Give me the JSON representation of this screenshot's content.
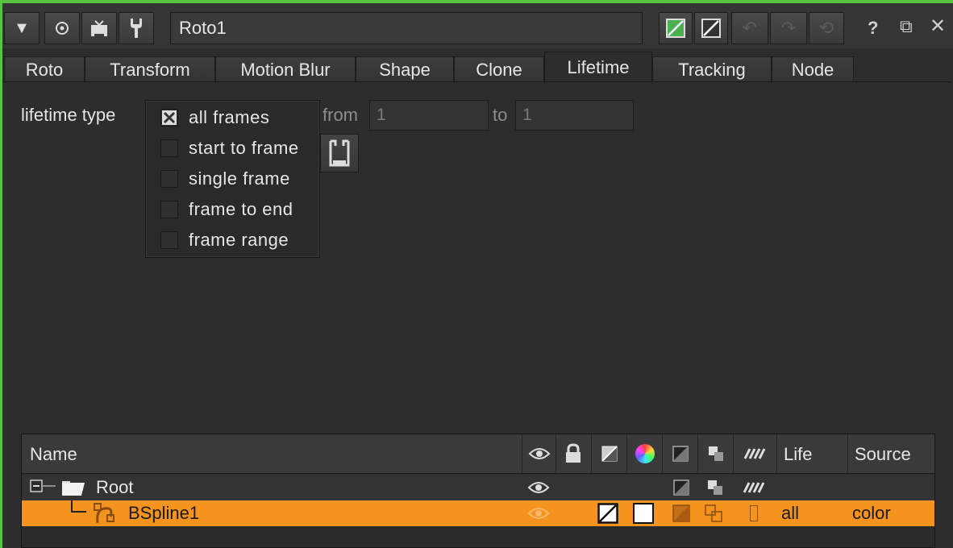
{
  "node": {
    "name": "Roto1"
  },
  "tabs": [
    {
      "label": "Roto"
    },
    {
      "label": "Transform"
    },
    {
      "label": "Motion Blur"
    },
    {
      "label": "Shape"
    },
    {
      "label": "Clone"
    },
    {
      "label": "Lifetime",
      "active": true
    },
    {
      "label": "Tracking"
    },
    {
      "label": "Node"
    }
  ],
  "lifetime": {
    "type_label": "lifetime type",
    "from_label": "from",
    "from_value": "1",
    "to_label": "to",
    "to_value": "1",
    "options": [
      {
        "label": "all frames",
        "checked": true
      },
      {
        "label": "start to frame",
        "checked": false
      },
      {
        "label": "single frame",
        "checked": false
      },
      {
        "label": "frame to end",
        "checked": false
      },
      {
        "label": "frame range",
        "checked": false
      }
    ]
  },
  "tree": {
    "columns": {
      "name": "Name",
      "life": "Life",
      "source": "Source"
    },
    "rows": [
      {
        "name": "Root",
        "life": "",
        "source": ""
      },
      {
        "name": "BSpline1",
        "life": "all",
        "source": "color",
        "selected": true
      }
    ]
  },
  "colors": {
    "accent_green": "#56c43f",
    "selection_orange": "#f5931f",
    "panel_bg": "#2d2d2d"
  }
}
